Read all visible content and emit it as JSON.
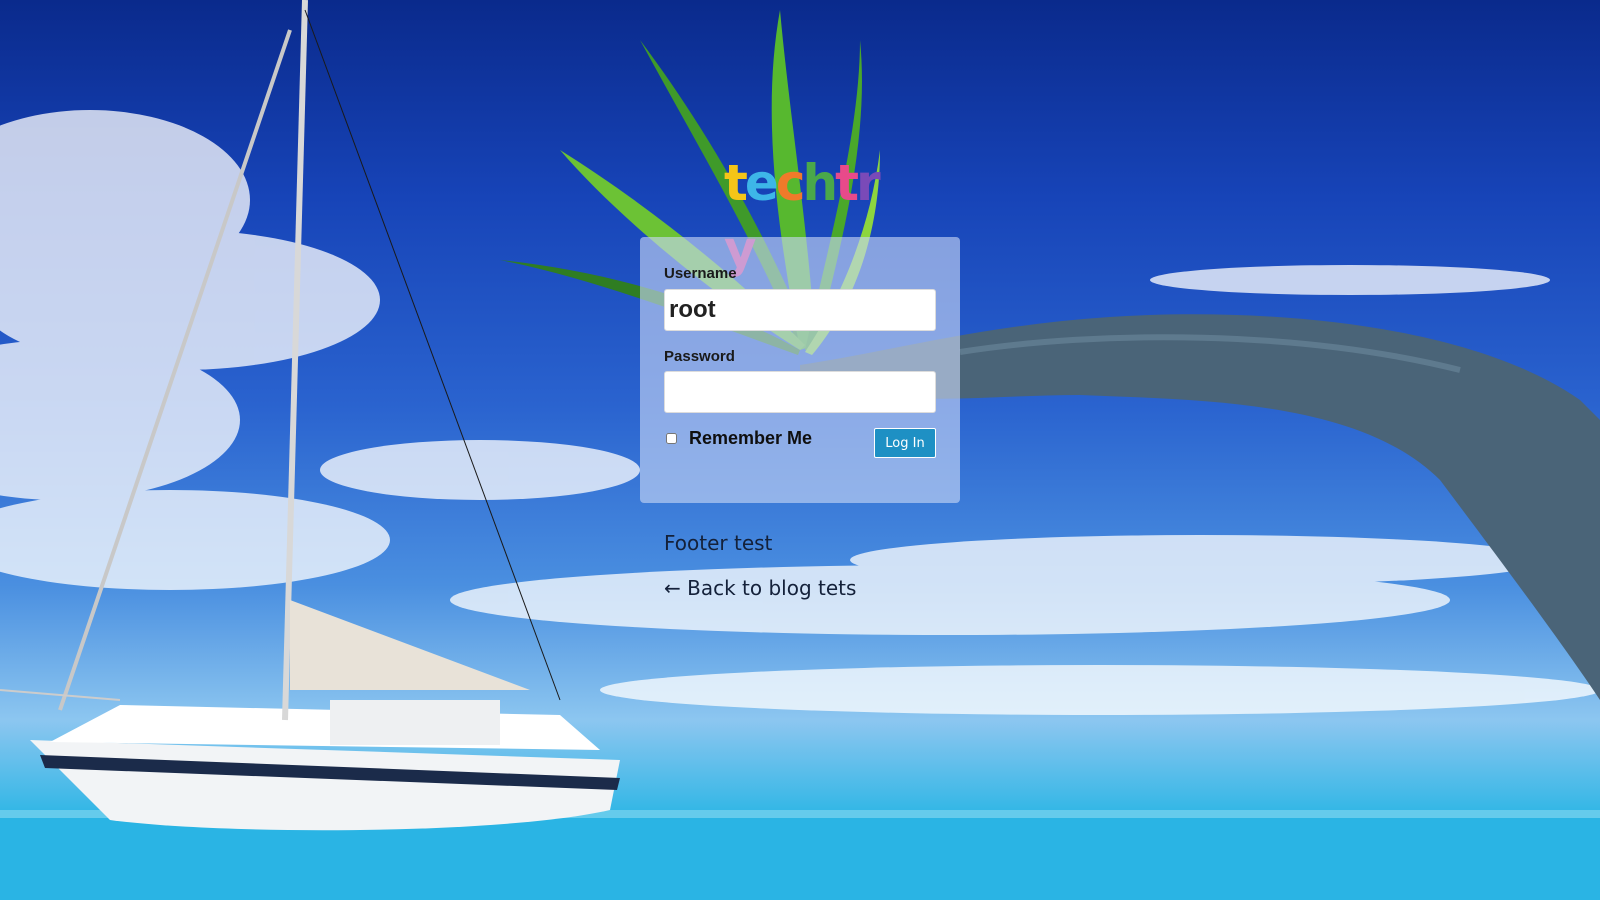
{
  "logo": {
    "letters": [
      {
        "char": "t",
        "color": "#f5c518"
      },
      {
        "char": "e",
        "color": "#3db6e8"
      },
      {
        "char": "c",
        "color": "#f07a2a"
      },
      {
        "char": "h",
        "color": "#4aa84a"
      },
      {
        "char": "t",
        "color": "#e84a8a"
      },
      {
        "char": "r",
        "color": "#7a4ab8"
      },
      {
        "char": "y",
        "color": "#d83a9a"
      }
    ]
  },
  "login": {
    "username_label": "Username",
    "username_value": "root",
    "password_label": "Password",
    "password_value": "",
    "remember_label": "Remember Me",
    "remember_checked": false,
    "submit_label": "Log In"
  },
  "footer": {
    "text": "Footer test",
    "back_link": "← Back to blog tets"
  },
  "colors": {
    "button": "#1e90c4",
    "sky_top": "#0a2a8c",
    "sea": "#1aa5d8"
  }
}
